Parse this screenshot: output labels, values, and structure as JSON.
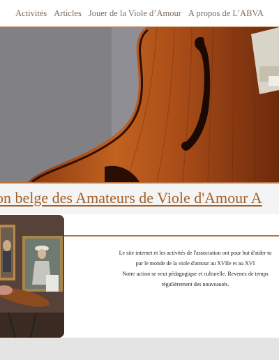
{
  "nav": {
    "items": [
      {
        "label": "Activités"
      },
      {
        "label": "Articles"
      },
      {
        "label": "Jouer de la Viole d’Amour"
      },
      {
        "label": "A propos de L’ABVA"
      }
    ]
  },
  "banner": {
    "title": "on belge des Amateurs de Viole d'Amour A"
  },
  "description": {
    "lines": [
      "Le site internet et les activités de l'association ont pour but d'aider to",
      "par le monde de la viole d'amour au XVIIe et au XVI",
      "Notre action se veut pédagogique et culturelle. Revenez de temps",
      "régulièrement des nouveautés."
    ]
  },
  "colors": {
    "accent": "#b67440",
    "nav_text": "#7a6a5e",
    "title": "#a0622d"
  }
}
